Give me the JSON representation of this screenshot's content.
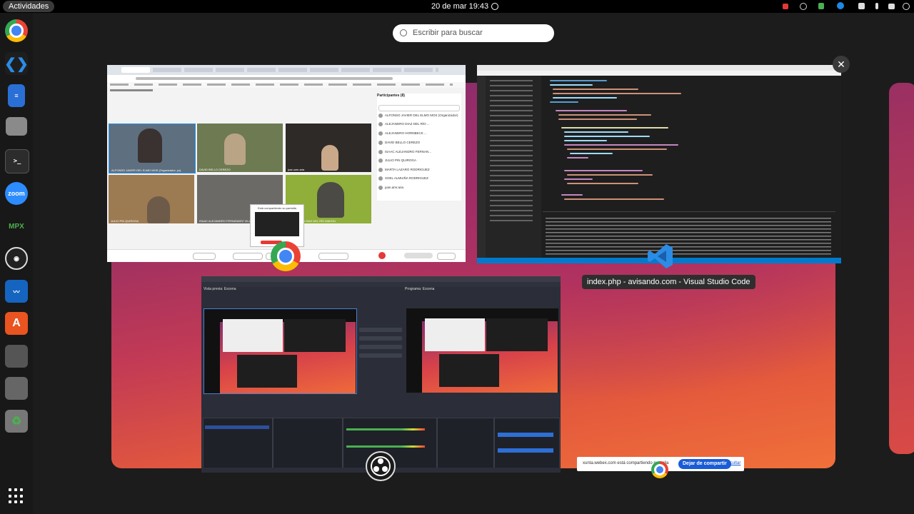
{
  "topbar": {
    "activities": "Actividades",
    "clock": "20 de mar  19:43"
  },
  "search": {
    "placeholder": "Escribir para buscar"
  },
  "dock": {
    "apps": [
      {
        "name": "chrome-icon",
        "color": "#4285f4"
      },
      {
        "name": "vscode-icon",
        "color": "#2b8ce6"
      },
      {
        "name": "text-editor-icon",
        "color": "#2a6fd6"
      },
      {
        "name": "files-icon",
        "color": "#888888"
      },
      {
        "name": "terminal-icon",
        "color": "#333333"
      },
      {
        "name": "zoom-icon",
        "color": "#2d8cff",
        "label": "zoom"
      },
      {
        "name": "mpx-icon",
        "color": "#b71c1c",
        "label": "MPX"
      },
      {
        "name": "obs-icon",
        "color": "#222222"
      },
      {
        "name": "system-monitor-icon",
        "color": "#1565c0"
      },
      {
        "name": "app-center-icon",
        "color": "#e95420"
      },
      {
        "name": "unknown-app-icon",
        "color": "#555555"
      },
      {
        "name": "disk-icon",
        "color": "#666666"
      },
      {
        "name": "trash-icon",
        "color": "#777777"
      }
    ]
  },
  "webex": {
    "participants_title": "Participantes (8)",
    "participants": [
      "ALFONSO JAVIER DEL ELMO MOS (Organizador)",
      "ALEJANDRO DIAZ DEL RÍO ...",
      "ALEJANDRO HORNBECK ...",
      "DAVID BELLO CEREZO",
      "ISAAC ALEJANDRO FERNAN...",
      "JULIO PIN QUIROGA",
      "MARTA LAZARO RODRIGUEZ",
      "XOEL ALMUIÑA RODRIGUEZ",
      "juan.amr.aria"
    ],
    "tiles": [
      {
        "label": "ALFONSO JAVIER DEL ELMO MOS (Organizador, yo)",
        "color": "#5e6f80"
      },
      {
        "label": "DAVID BELLO CEREZO",
        "color": "#6d7a52"
      },
      {
        "label": "juan.amr.aria",
        "color": "#2e2a28"
      },
      {
        "label": "JULIO PIN QUIROGA",
        "color": "#9c7a52"
      },
      {
        "label": "ISAAC ALEJANDRO FERNÁNDEZ VILA",
        "color": "#6c6a66"
      },
      {
        "label": "ALEJANDRO DIAZ DEL RÍO MAHOU",
        "color": "#8fae3a"
      }
    ],
    "share_dialog_title": "Está compartiendo su pantalla"
  },
  "vscode": {
    "window_label": "index.php - avisando.com - Visual Studio Code"
  },
  "obs": {
    "preview_label": "Vista previa: Escena",
    "program_label": "Programa: Escena"
  },
  "sharebar": {
    "text": "xunta.webex.com está compartiendo pantalla",
    "stop": "Dejar de compartir",
    "hide": "Ocultar"
  }
}
